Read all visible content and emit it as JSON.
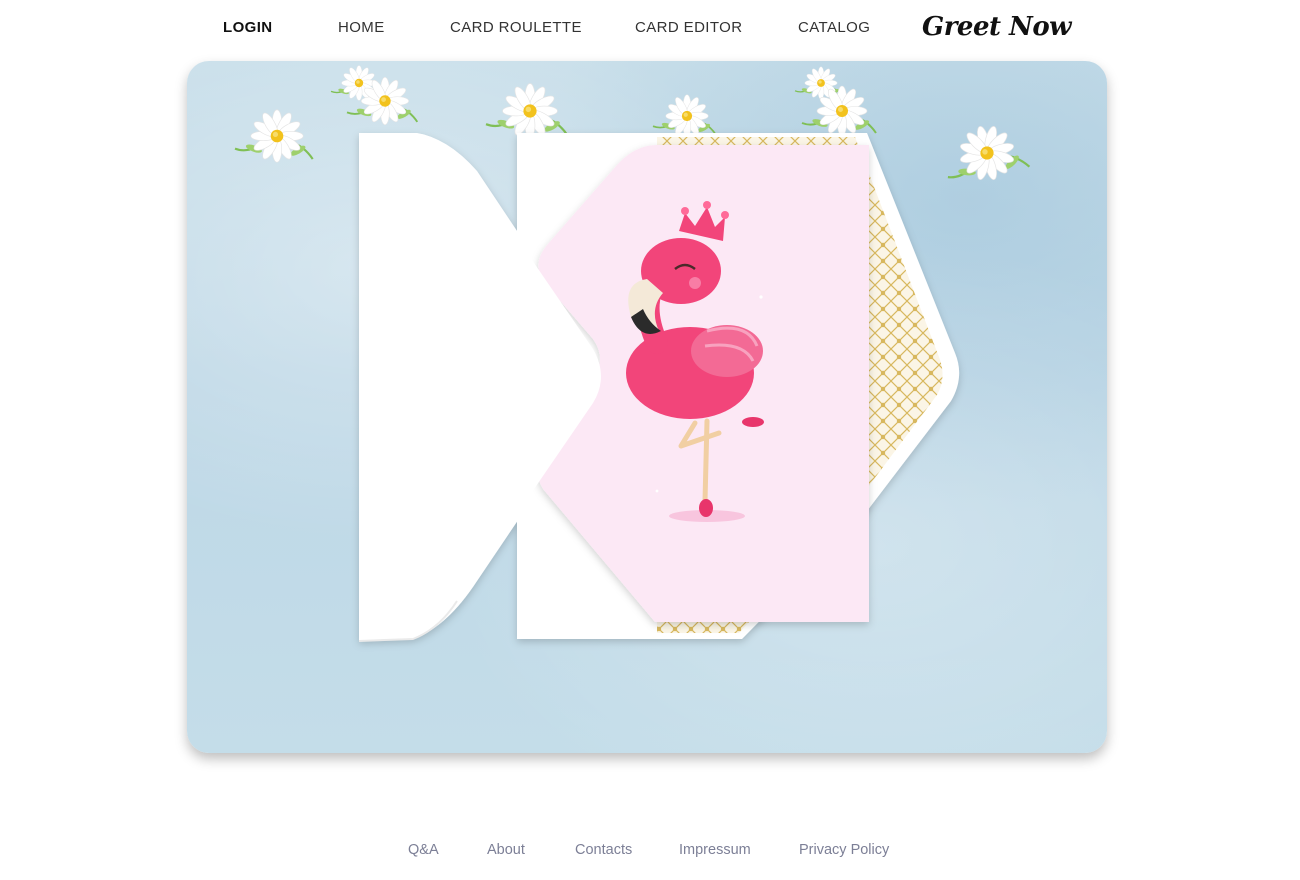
{
  "nav": {
    "login": "LOGIN",
    "home": "HOME",
    "card_roulette": "CARD ROULETTE",
    "card_editor": "CARD EDITOR",
    "catalog": "CATALOG",
    "logo": "Greet Now"
  },
  "hero": {
    "card_illustration": "pink flamingo with crown",
    "decorations": "daisy flowers",
    "colors": {
      "background": "#c6dde9",
      "card": "#fce8f5",
      "flamingo": "#f2457a",
      "envelope_liner": "#d8b85e"
    }
  },
  "footer": {
    "links": [
      "Q&A",
      "About",
      "Contacts",
      "Impressum",
      "Privacy Policy"
    ]
  }
}
